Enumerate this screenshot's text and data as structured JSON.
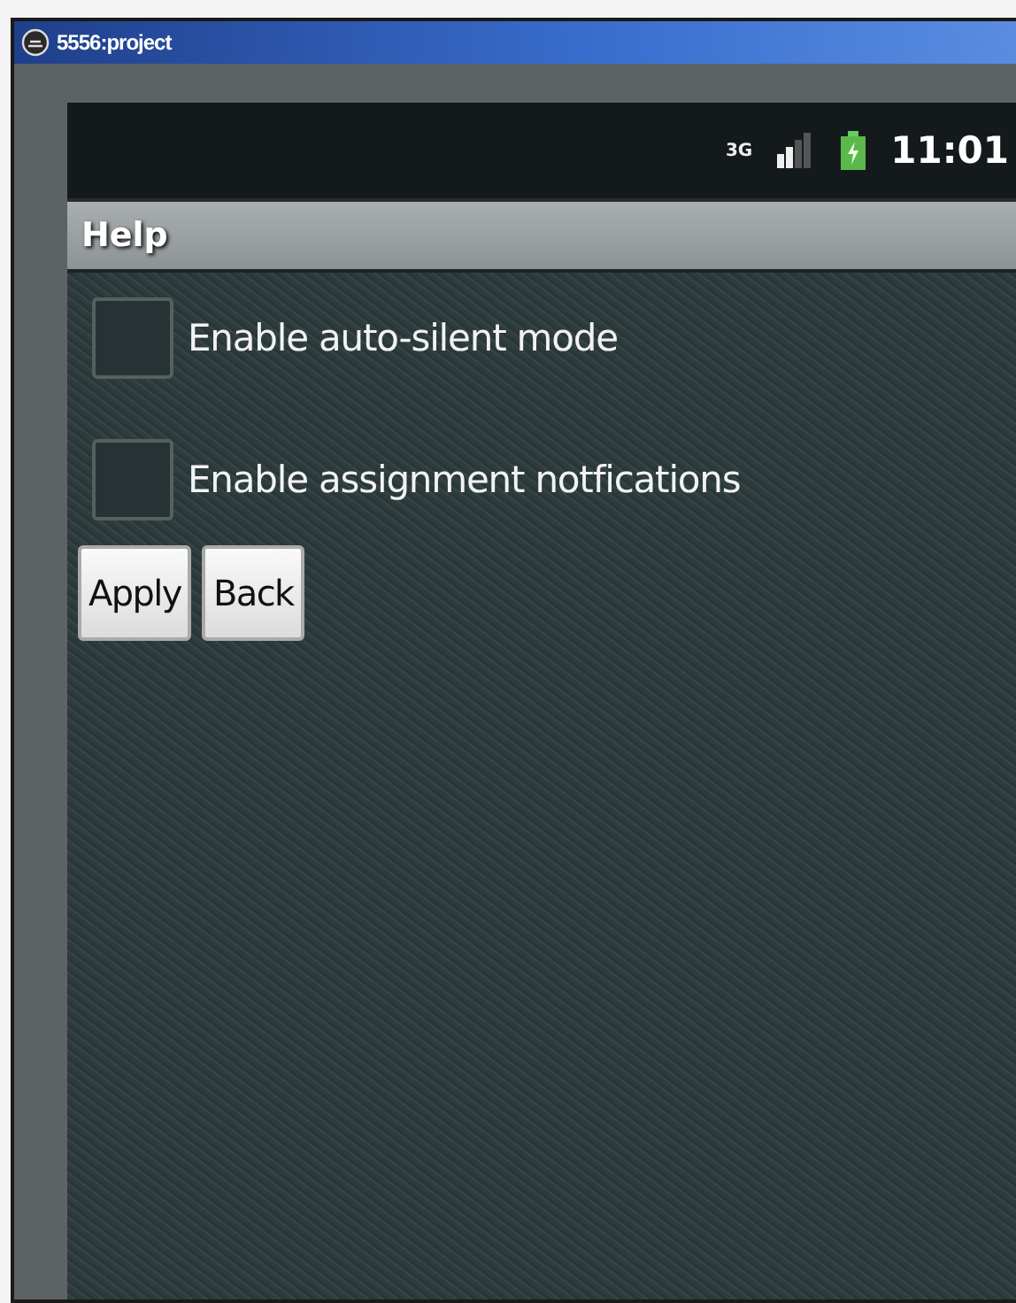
{
  "window": {
    "title": "5556:project"
  },
  "status_bar": {
    "network": "3G",
    "time": "11:01"
  },
  "app_title": "Help",
  "options": [
    {
      "label": "Enable auto-silent mode",
      "checked": false
    },
    {
      "label": "Enable assignment notfications",
      "checked": false
    }
  ],
  "buttons": [
    "Apply",
    "Back"
  ]
}
